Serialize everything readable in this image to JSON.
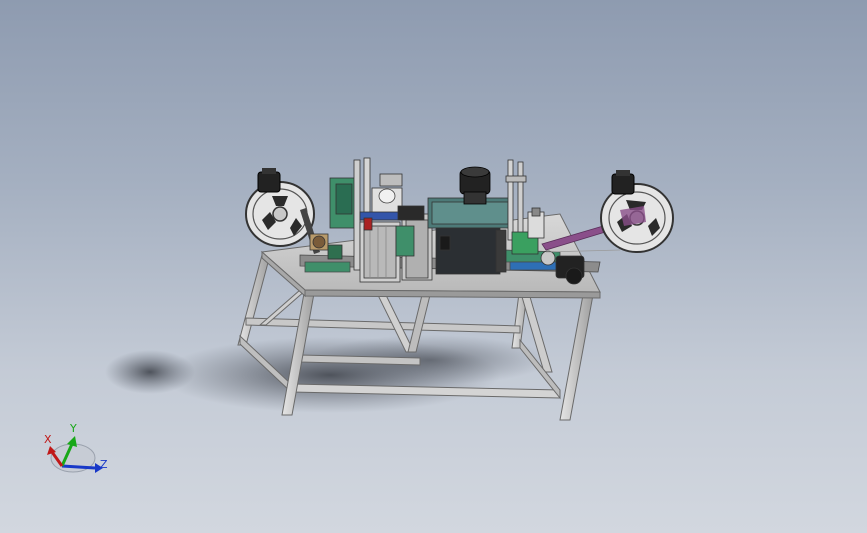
{
  "viewport": {
    "background_top": "#8e9bb0",
    "background_bottom": "#d2d7df"
  },
  "model": {
    "description_icon": "taping-machine-assembly-icon"
  },
  "triad": {
    "x_label": "X",
    "y_label": "Y",
    "z_label": "Z",
    "x_color": "#c01818",
    "y_color": "#18a818",
    "z_color": "#1838c8"
  }
}
